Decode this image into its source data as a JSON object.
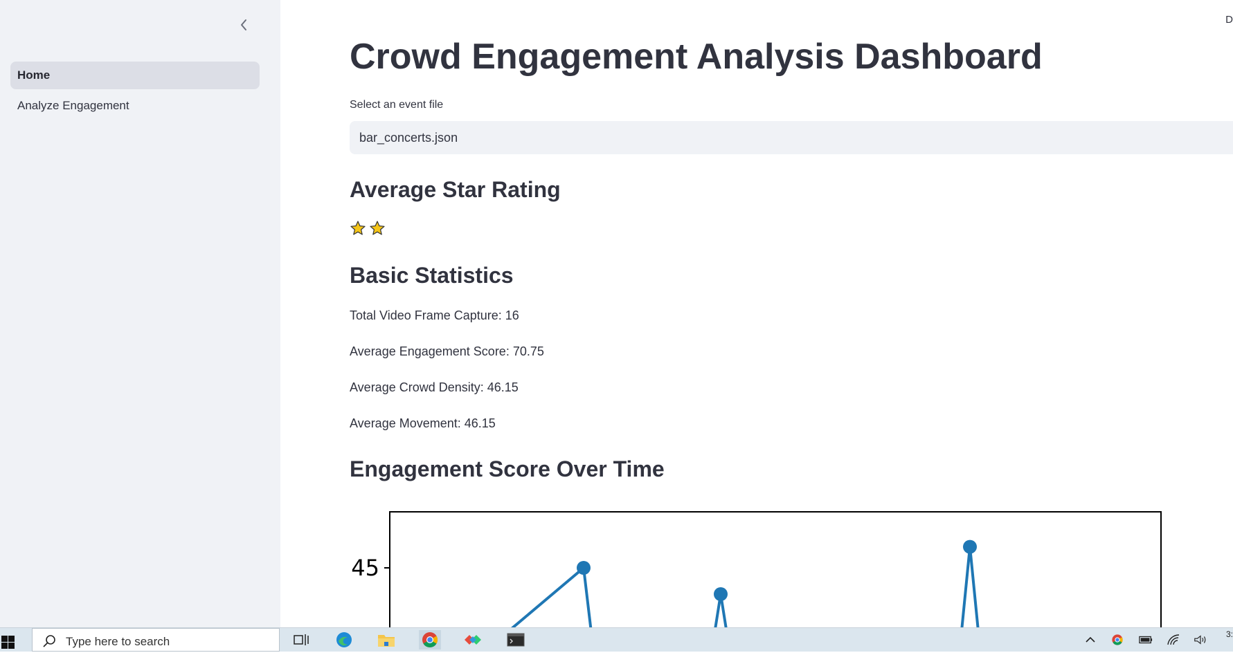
{
  "sidebar": {
    "collapse_icon": "chevron-left-icon",
    "items": [
      {
        "label": "Home",
        "active": true
      },
      {
        "label": "Analyze Engagement",
        "active": false
      }
    ]
  },
  "header": {
    "deploy_label": "D"
  },
  "main": {
    "title": "Crowd Engagement Analysis Dashboard",
    "select": {
      "label": "Select an event file",
      "value": "bar_concerts.json"
    },
    "rating": {
      "heading": "Average Star Rating",
      "stars": 2,
      "star_color": "#f5c518"
    },
    "stats": {
      "heading": "Basic Statistics",
      "lines": [
        "Total Video Frame Capture: 16",
        "Average Engagement Score: 70.75",
        "Average Crowd Density: 46.15",
        "Average Movement: 46.15"
      ]
    },
    "chart_heading": "Engagement Score Over Time"
  },
  "chart_data": {
    "type": "line",
    "title": "",
    "xlabel": "",
    "ylabel": "",
    "y_ticks": [
      "0.45"
    ],
    "line_color": "#1f77b4",
    "series": [
      {
        "points": [
          {
            "x": 1,
            "y": 0.37
          },
          {
            "x": 2,
            "y": 0.45
          },
          {
            "x": 2.1,
            "y": 0.37
          },
          {
            "x": 3,
            "y": 0.37
          },
          {
            "x": 3.1,
            "y": 0.43
          },
          {
            "x": 3.2,
            "y": 0.37
          },
          {
            "x": 5,
            "y": 0.37
          },
          {
            "x": 5.1,
            "y": 0.466
          },
          {
            "x": 5.2,
            "y": 0.37
          }
        ]
      }
    ]
  },
  "taskbar": {
    "search_placeholder": "Type here to search",
    "apps": [
      "task-view-icon",
      "edge-icon",
      "file-explorer-icon",
      "chrome-icon",
      "dev-tool-icon",
      "terminal-icon"
    ],
    "tray": [
      "chevron-up-icon",
      "chrome-icon",
      "battery-icon",
      "wifi-icon",
      "volume-icon"
    ],
    "clock": "3:"
  }
}
